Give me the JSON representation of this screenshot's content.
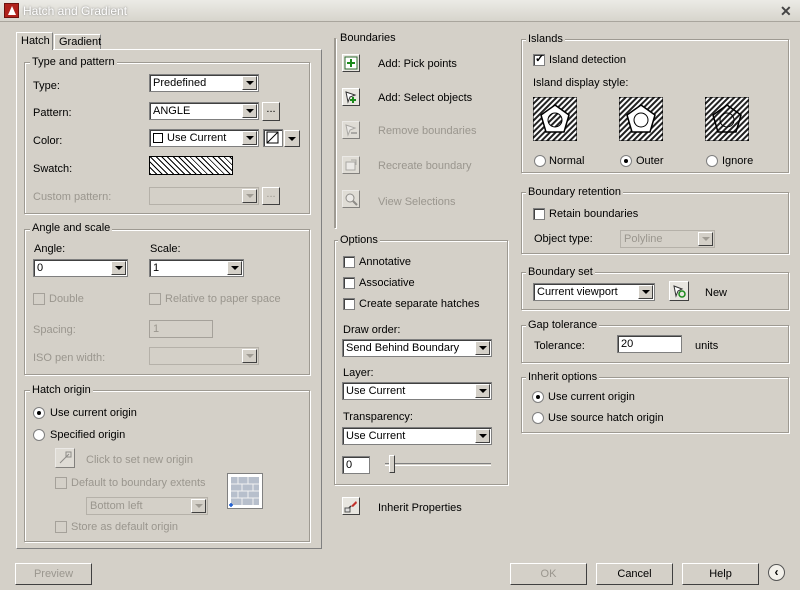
{
  "window": {
    "title": "Hatch and Gradient"
  },
  "tabs": [
    "Hatch",
    "Gradient"
  ],
  "type_pattern": {
    "group": "Type and pattern",
    "type_label": "Type:",
    "type_value": "Predefined",
    "pattern_label": "Pattern:",
    "pattern_value": "ANGLE",
    "browse": "...",
    "color_label": "Color:",
    "color_value": "Use Current",
    "swatch_label": "Swatch:",
    "custom_label": "Custom pattern:",
    "custom_browse": "..."
  },
  "angle_scale": {
    "group": "Angle and scale",
    "angle_label": "Angle:",
    "angle_value": "0",
    "scale_label": "Scale:",
    "scale_value": "1",
    "double": "Double",
    "relative": "Relative to paper space",
    "spacing_label": "Spacing:",
    "spacing_value": "1",
    "iso_label": "ISO pen width:"
  },
  "origin": {
    "group": "Hatch origin",
    "use_current": "Use current origin",
    "specified": "Specified origin",
    "click_set": "Click to set new origin",
    "default_extents": "Default to boundary extents",
    "position_value": "Bottom left",
    "store_default": "Store as default origin"
  },
  "boundaries": {
    "group": "Boundaries",
    "pick": "Add: Pick points",
    "select": "Add: Select objects",
    "remove": "Remove boundaries",
    "recreate": "Recreate boundary",
    "view": "View Selections"
  },
  "options": {
    "group": "Options",
    "annotative": "Annotative",
    "associative": "Associative",
    "separate": "Create separate hatches",
    "draw_order_label": "Draw order:",
    "draw_order_value": "Send Behind Boundary",
    "layer_label": "Layer:",
    "layer_value": "Use Current",
    "transparency_label": "Transparency:",
    "transparency_value": "Use Current",
    "transparency_num": "0"
  },
  "inherit_props": "Inherit Properties",
  "islands": {
    "group": "Islands",
    "detection": "Island detection",
    "style_label": "Island display style:",
    "normal": "Normal",
    "outer": "Outer",
    "ignore": "Ignore"
  },
  "retention": {
    "group": "Boundary retention",
    "retain": "Retain boundaries",
    "object_type_label": "Object type:",
    "object_type_value": "Polyline"
  },
  "boundary_set": {
    "group": "Boundary set",
    "value": "Current viewport",
    "new_label": "New"
  },
  "gap": {
    "group": "Gap tolerance",
    "label": "Tolerance:",
    "value": "20",
    "units": "units"
  },
  "inherit_opts": {
    "group": "Inherit options",
    "current": "Use current origin",
    "source": "Use source hatch origin"
  },
  "buttons": {
    "preview": "Preview",
    "ok": "OK",
    "cancel": "Cancel",
    "help": "Help"
  }
}
